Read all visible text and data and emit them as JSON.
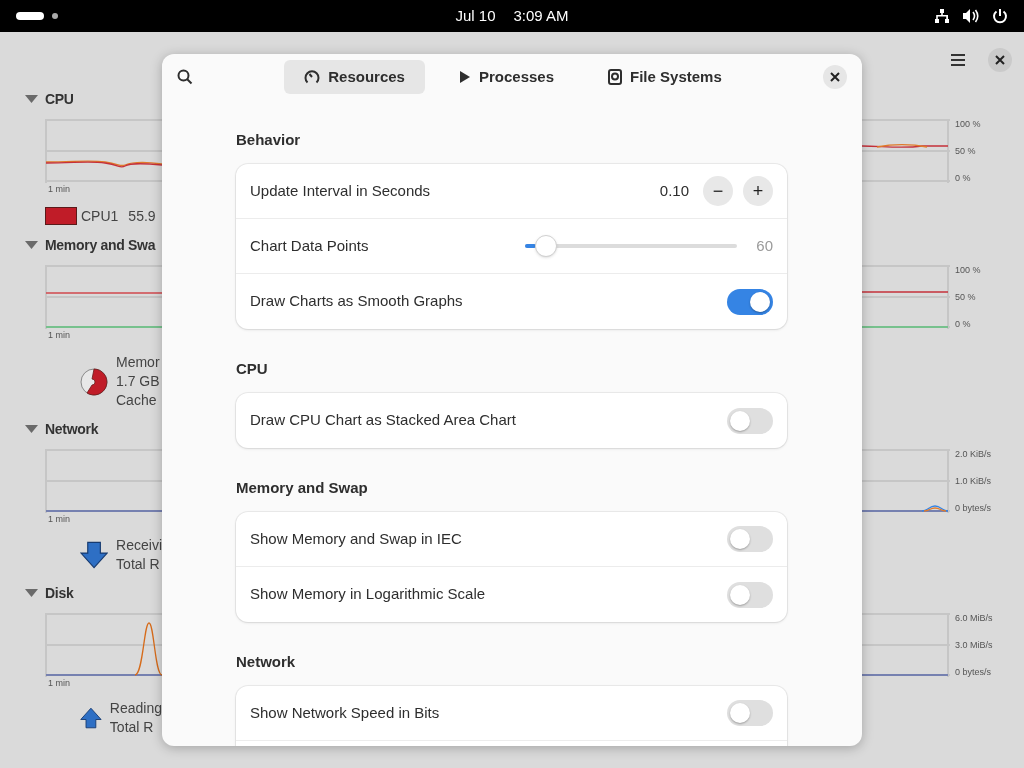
{
  "top_bar": {
    "date": "Jul 10",
    "time": "3:09 AM"
  },
  "background_window": {
    "sections": [
      {
        "kind": "cpu",
        "title": "CPU",
        "expanded": true,
        "time_label": "1 min",
        "axis_labels": [
          "100 %",
          "50 %",
          "0 %"
        ],
        "legend": [
          {
            "label": "CPU1",
            "value": "55.9",
            "color": "#c01c28"
          }
        ]
      },
      {
        "kind": "memory",
        "title": "Memory and Swa",
        "expanded": true,
        "time_label": "1 min",
        "axis_labels": [
          "100 %",
          "50 %",
          "0 %"
        ],
        "lines": [
          "Memor",
          "1.7 GB",
          "Cache"
        ]
      },
      {
        "kind": "network",
        "title": "Network",
        "expanded": true,
        "time_label": "1 min",
        "axis_labels": [
          "2.0 KiB/s",
          "1.0 KiB/s",
          "0 bytes/s"
        ],
        "lines": [
          "Receivi",
          "Total R"
        ]
      },
      {
        "kind": "disk",
        "title": "Disk",
        "expanded": true,
        "time_label": "1 min",
        "axis_labels": [
          "6.0 MiB/s",
          "3.0 MiB/s",
          "0 bytes/s"
        ],
        "lines": [
          "Reading",
          "Total R"
        ]
      }
    ]
  },
  "dialog": {
    "tabs": [
      {
        "label": "Resources",
        "kind": "gauge",
        "selected": true
      },
      {
        "label": "Processes",
        "kind": "play",
        "selected": false
      },
      {
        "label": "File Systems",
        "kind": "disk",
        "selected": false
      }
    ],
    "sections": [
      {
        "title": "Behavior",
        "rows": [
          {
            "kind": "stepper",
            "label": "Update Interval in Seconds",
            "value": "0.10",
            "minus": "−",
            "plus": "+"
          },
          {
            "kind": "slider",
            "label": "Chart Data Points",
            "level": 0.05,
            "value": "60"
          },
          {
            "kind": "switch",
            "label": "Draw Charts as Smooth Graphs",
            "on": true
          }
        ]
      },
      {
        "title": "CPU",
        "rows": [
          {
            "kind": "switch",
            "label": "Draw CPU Chart as Stacked Area Chart",
            "on": false
          }
        ]
      },
      {
        "title": "Memory and Swap",
        "rows": [
          {
            "kind": "switch",
            "label": "Show Memory and Swap in IEC",
            "on": false
          },
          {
            "kind": "switch",
            "label": "Show Memory in Logarithmic Scale",
            "on": false
          }
        ]
      },
      {
        "title": "Network",
        "rows": [
          {
            "kind": "switch",
            "label": "Show Network Speed in Bits",
            "on": false
          }
        ]
      }
    ]
  }
}
